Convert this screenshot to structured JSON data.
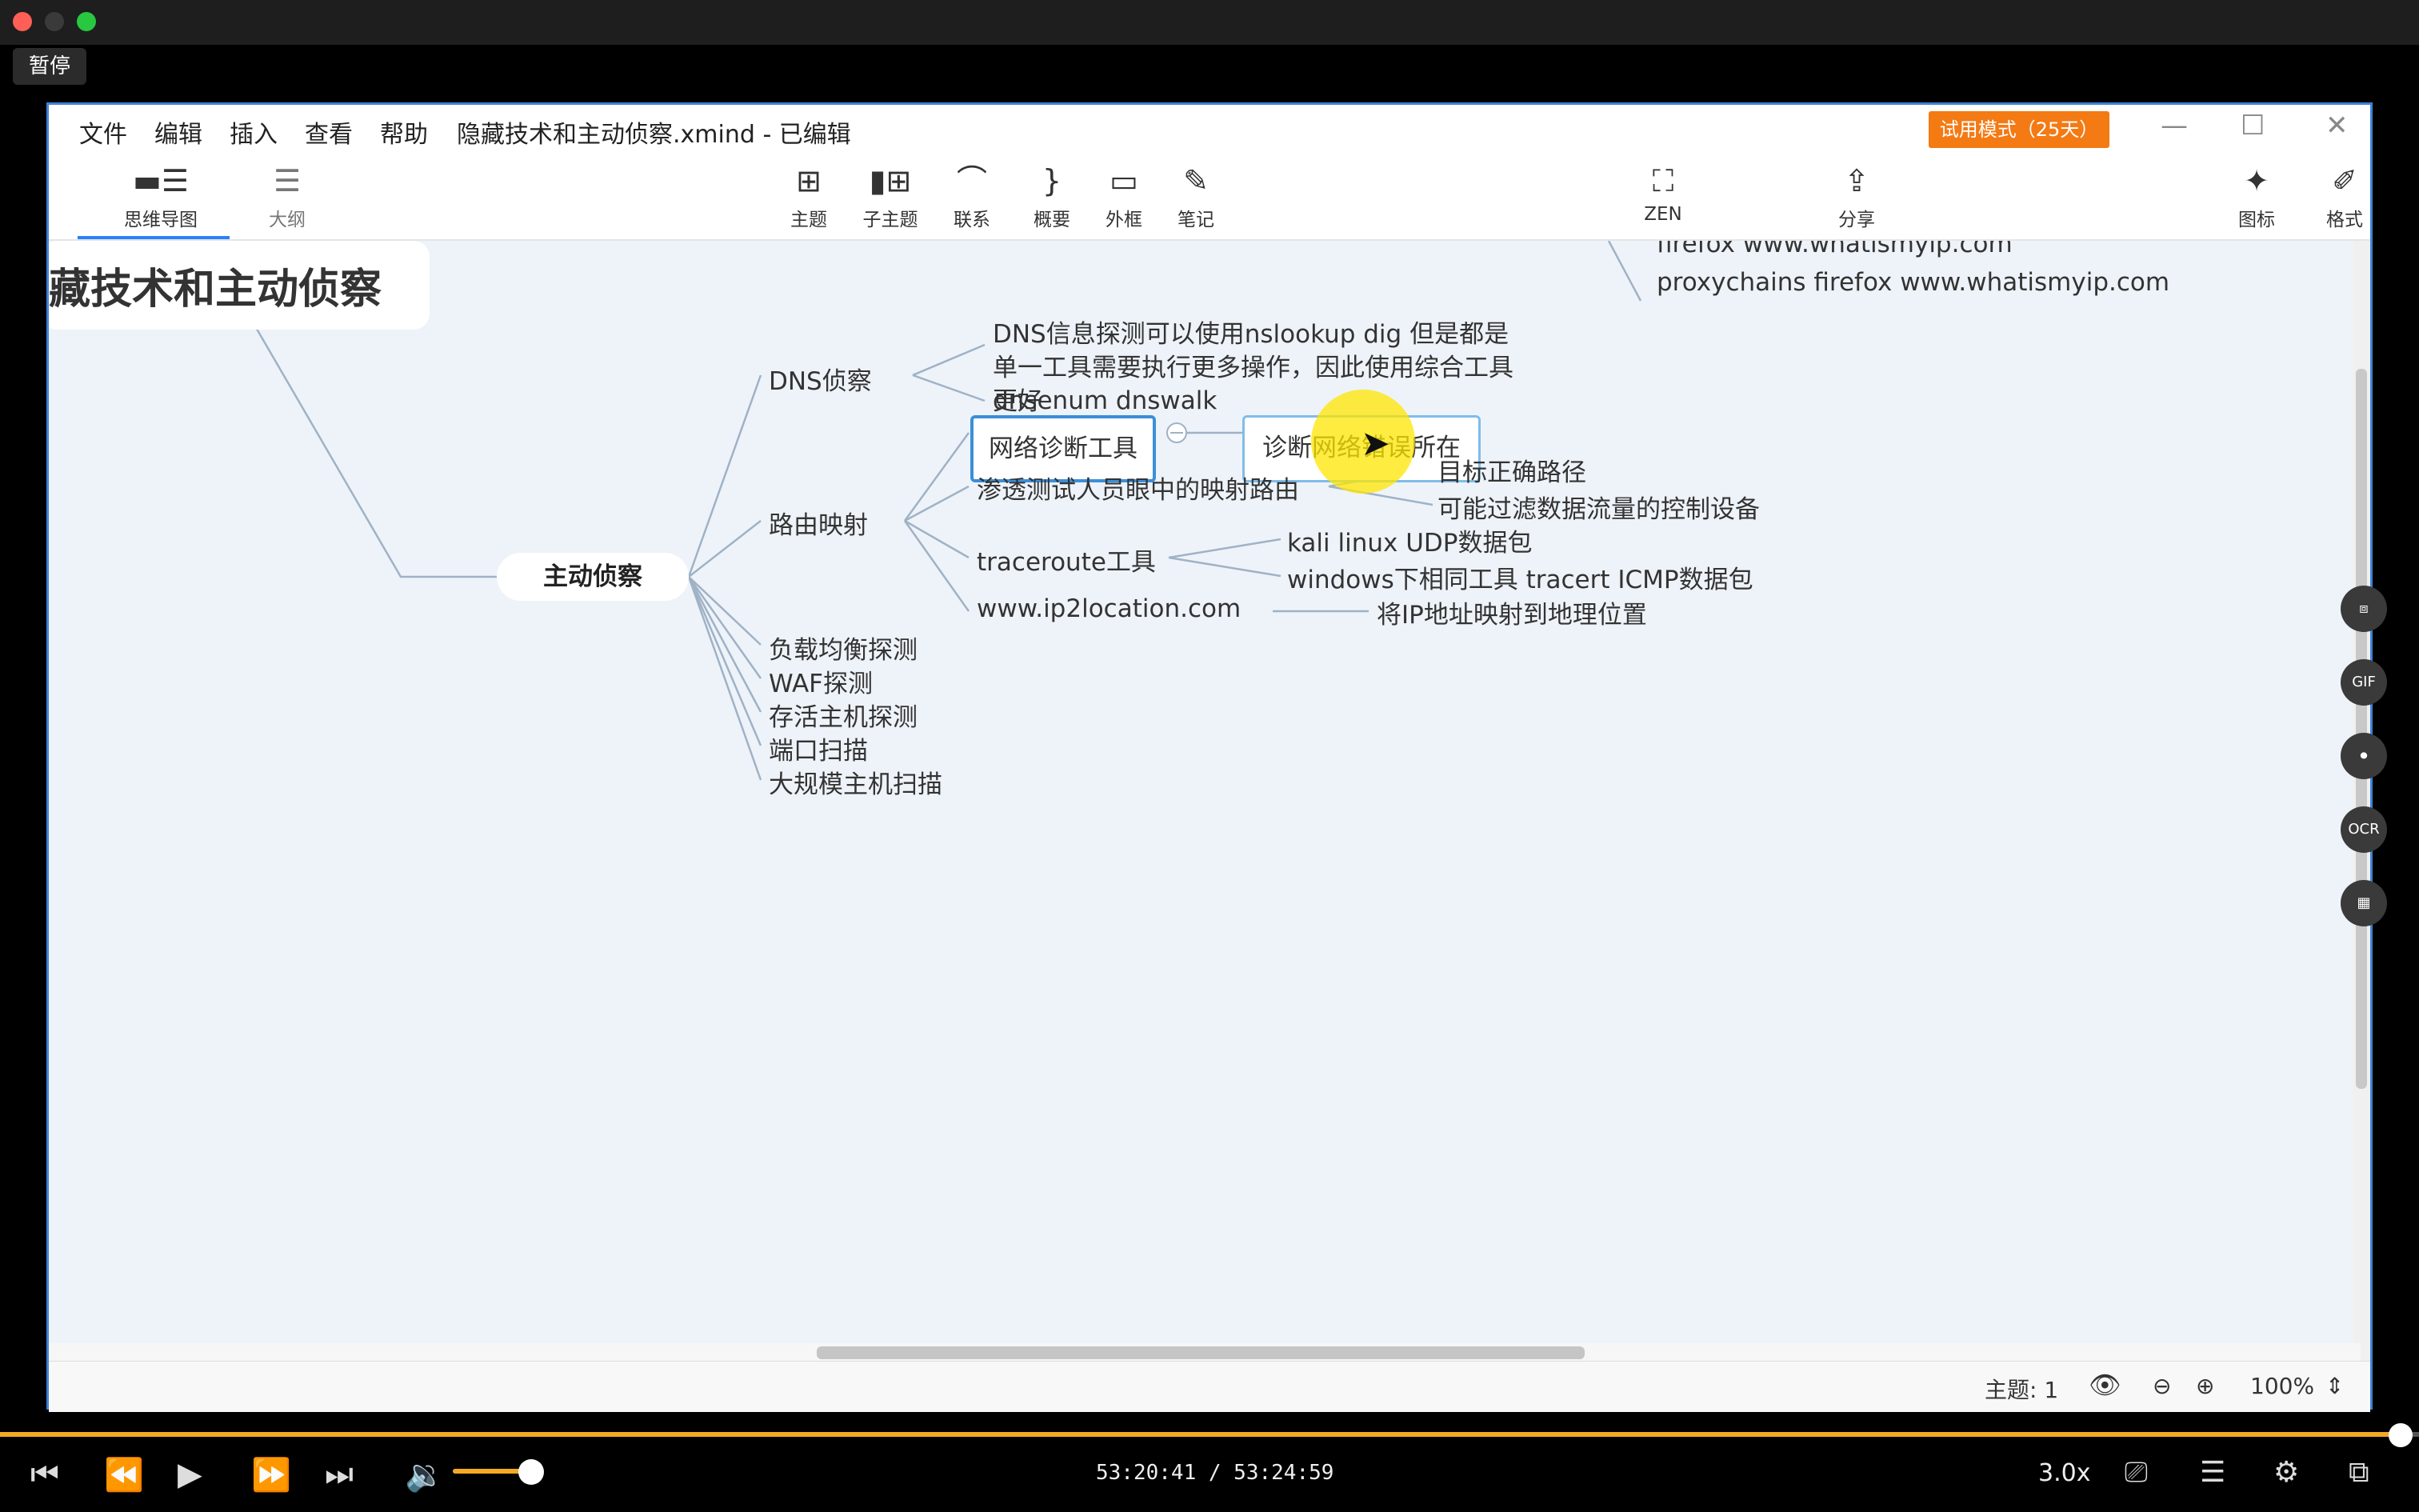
{
  "player": {
    "pause_tooltip": "暂停",
    "time": "53:20:41 / 53:24:59",
    "speed": "3.0x",
    "progress_fraction": 0.989,
    "volume_fraction": 0.7
  },
  "app": {
    "menu": [
      "文件",
      "编辑",
      "插入",
      "查看",
      "帮助"
    ],
    "doc_title": "隐藏技术和主动侦察.xmind - 已编辑",
    "trial_badge": "试用模式（25天）",
    "view_tabs": [
      {
        "label": "思维导图",
        "icon": "mindmap-icon",
        "active": true
      },
      {
        "label": "大纲",
        "icon": "outline-icon",
        "active": false
      }
    ],
    "tools": [
      {
        "label": "主题",
        "icon": "topic-icon"
      },
      {
        "label": "子主题",
        "icon": "subtopic-icon"
      },
      {
        "label": "联系",
        "icon": "relationship-icon"
      },
      {
        "label": "概要",
        "icon": "summary-icon"
      },
      {
        "label": "外框",
        "icon": "boundary-icon"
      },
      {
        "label": "笔记",
        "icon": "note-icon"
      }
    ],
    "right_tools": [
      {
        "label": "ZEN",
        "icon": "zen-icon"
      },
      {
        "label": "分享",
        "icon": "share-icon"
      },
      {
        "label": "图标",
        "icon": "icons-icon"
      },
      {
        "label": "格式",
        "icon": "format-icon"
      }
    ],
    "status": {
      "topic_count": "主题: 1",
      "zoom": "100%"
    }
  },
  "mindmap": {
    "root_title": "藏技术和主动侦察",
    "upper_fragments": [
      "firefox www.whatismyip.com",
      "proxychains firefox www.whatismyip.com"
    ],
    "central": "主动侦察",
    "dns": {
      "label": "DNS侦察",
      "note_lines": [
        "DNS信息探测可以使用nslookup dig 但是都是",
        "单一工具需要执行更多操作，因此使用综合工具",
        "更好"
      ],
      "tools": "dnsenum dnswalk"
    },
    "net_diag": {
      "label": "网络诊断工具",
      "child": "诊断网络错误所在"
    },
    "route": {
      "label": "路由映射",
      "pentest": "渗透测试人员眼中的映射路由",
      "pentest_children": [
        "目标正确路径",
        "可能过滤数据流量的控制设备"
      ],
      "traceroute": "traceroute工具",
      "traceroute_children": [
        "kali linux UDP数据包",
        "windows下相同工具  tracert ICMP数据包"
      ],
      "ip2location": "www.ip2location.com",
      "ip2location_child": "将IP地址映射到地理位置"
    },
    "other_branches": [
      "负载均衡探测",
      "WAF探测",
      "存活主机探测",
      "端口扫描",
      "大规模主机扫描"
    ]
  },
  "side_tools": [
    "crop-icon",
    "GIF",
    "record-icon",
    "OCR",
    "layout-icon"
  ],
  "colors": {
    "accent": "#3b8fd9",
    "trial": "#f47a14",
    "progress": "#f3a924",
    "canvas": "#eef3f9"
  }
}
